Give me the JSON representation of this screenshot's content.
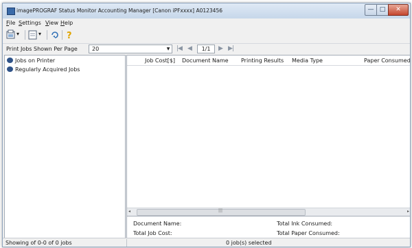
{
  "window": {
    "title": "imagePROGRAF Status Monitor Accounting Manager [Canon iPFxxxx] A0123456",
    "min_glyph": "—",
    "max_glyph": "□",
    "close_glyph": "✕"
  },
  "menu": {
    "items": [
      {
        "key": "F",
        "rest": "ile"
      },
      {
        "key": "S",
        "rest": "ettings"
      },
      {
        "key": "V",
        "rest": "iew"
      },
      {
        "key": "H",
        "rest": "elp"
      }
    ]
  },
  "toolbar": {
    "dropdown_glyph": "▾",
    "icons": [
      "export-icon",
      "settings-icon",
      "refresh-icon",
      "help-icon"
    ]
  },
  "pager": {
    "label": "Print Jobs Shown Per Page",
    "per_page": "20",
    "dropdown_glyph": "▼",
    "first": "|◀",
    "prev": "◀",
    "page": "1/1",
    "next": "▶",
    "last": "▶|"
  },
  "tree": {
    "items": [
      {
        "label": "Jobs on Printer"
      },
      {
        "label": "Regularly Acquired Jobs"
      }
    ]
  },
  "grid": {
    "columns": [
      "Job Cost[$]",
      "Document Name",
      "Printing Results",
      "Media Type",
      "Paper Consumed[m"
    ],
    "scroll_left": "◂",
    "scroll_right": "▸",
    "scroll_grip": "|||"
  },
  "details": {
    "document_name": "Document Name:",
    "total_job_cost": "Total Job Cost:",
    "total_ink": "Total Ink Consumed:",
    "total_paper": "Total Paper Consumed:"
  },
  "status": {
    "left": "Showing of 0-0 of 0 jobs",
    "center": "0 job(s) selected"
  },
  "colors": {
    "titlebar": "#c6d7ea",
    "close_button": "#c4462f",
    "help_icon": "#e0a500",
    "refresh_icon": "#2f6fb5"
  }
}
